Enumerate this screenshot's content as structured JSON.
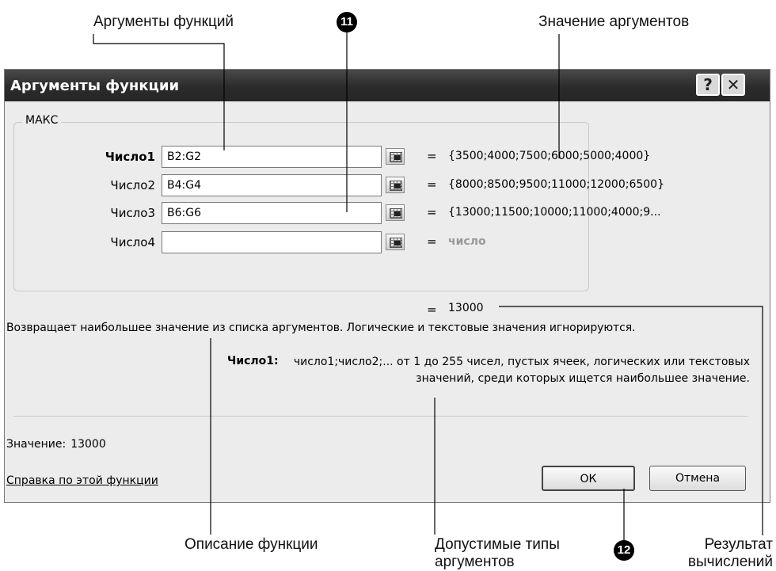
{
  "callouts": {
    "function_args": "Аргументы функций",
    "arg_values": "Значение аргументов",
    "func_description": "Описание функции",
    "allowed_types": "Допустимые типы аргументов",
    "result": "Результат вычислений",
    "marker_11": "11",
    "marker_12": "12"
  },
  "dialog": {
    "title": "Аргументы функции",
    "help_button": "?",
    "close_button": "✕",
    "function_name": "МАКС",
    "args": [
      {
        "label": "Число1",
        "value": "B2:G2",
        "result": "{3500;4000;7500;6000;5000;4000}"
      },
      {
        "label": "Число2",
        "value": "B4:G4",
        "result": "{8000;8500;9500;11000;12000;6500}"
      },
      {
        "label": "Число3",
        "value": "B6:G6",
        "result": "{13000;11500;10000;11000;4000;9..."
      },
      {
        "label": "Число4",
        "value": "",
        "result": "число"
      }
    ],
    "equals": "=",
    "formula_result": "13000",
    "description": "Возвращает наибольшее значение из списка аргументов. Логические и текстовые значения игнорируются.",
    "arg_desc_label": "Число1:",
    "arg_desc": "число1;число2;... от 1 до 255 чисел, пустых ячеек, логических или текстовых значений, среди которых ищется наибольшее значение.",
    "value_label": "Значение:",
    "value": "13000",
    "help_link": "Справка по этой функции",
    "ok": "ОК",
    "cancel": "Отмена"
  }
}
